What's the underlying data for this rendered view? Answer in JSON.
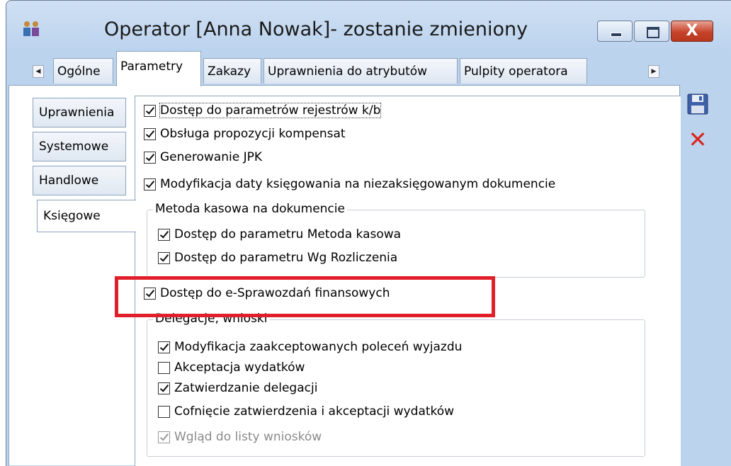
{
  "window": {
    "title": "Operator [Anna Nowak]- zostanie zmieniony",
    "close_glyph": "X"
  },
  "tabs": [
    {
      "label": "Ogólne",
      "active": false
    },
    {
      "label": "Parametry",
      "active": true
    },
    {
      "label": "Zakazy",
      "active": false
    },
    {
      "label": "Uprawnienia do atrybutów",
      "active": false
    },
    {
      "label": "Pulpity operatora",
      "active": false
    }
  ],
  "scroll": {
    "left": "◀",
    "right": "▶"
  },
  "side_tabs": [
    {
      "label": "Uprawnienia",
      "active": false
    },
    {
      "label": "Systemowe",
      "active": false
    },
    {
      "label": "Handlowe",
      "active": false
    },
    {
      "label": "Księgowe",
      "active": true
    }
  ],
  "options": [
    {
      "label": "Dostęp do parametrów rejestrów k/b",
      "checked": true
    },
    {
      "label": "Obsługa propozycji kompensat",
      "checked": true
    },
    {
      "label": "Generowanie JPK",
      "checked": true
    },
    {
      "label": "Modyfikacja daty księgowania na niezaksięgowanym dokumencie",
      "checked": true
    }
  ],
  "group_kasowa": {
    "legend": "Metoda kasowa na dokumencie",
    "items": [
      {
        "label": "Dostęp do parametru Metoda kasowa",
        "checked": true
      },
      {
        "label": "Dostęp do parametru Wg Rozliczenia",
        "checked": true
      }
    ]
  },
  "esprawozdania": {
    "label": "Dostęp do e-Sprawozdań finansowych",
    "checked": true
  },
  "group_delegacje": {
    "legend": "Delegacje, wnioski",
    "items": [
      {
        "label": "Modyfikacja zaakceptowanych poleceń wyjazdu",
        "checked": true
      },
      {
        "label": "Akceptacja wydatków",
        "checked": false
      },
      {
        "label": "Zatwierdzanie delegacji",
        "checked": true
      },
      {
        "label": "Cofnięcie zatwierdzenia i akceptacji wydatków",
        "checked": false
      },
      {
        "label": "Wgląd do listy wniosków",
        "checked": true,
        "disabled": true
      }
    ]
  },
  "toolbar": {
    "save_icon": "floppy-disk-icon",
    "cancel_icon": "red-x-icon",
    "cancel_glyph": "✕"
  },
  "colors": {
    "highlight": "#e01f2a",
    "close_button": "#c7432b",
    "cancel": "#d9261c"
  }
}
